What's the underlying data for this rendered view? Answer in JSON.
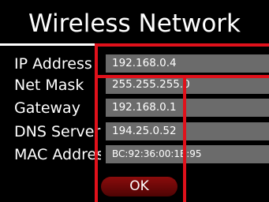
{
  "window": {
    "title": "Wireless Network"
  },
  "fields": [
    {
      "label": "IP Address",
      "value": "192.168.0.4"
    },
    {
      "label": "Net Mask",
      "value": "255.255.255.0"
    },
    {
      "label": "Gateway",
      "value": "192.168.0.1"
    },
    {
      "label": "DNS Server",
      "value": "194.25.0.52"
    },
    {
      "label": "MAC Address",
      "value": "BC:92:36:00:1B:95"
    }
  ],
  "actions": {
    "ok_label": "OK"
  },
  "colors": {
    "background": "#000000",
    "field_background": "#6b6b6b",
    "ok_button": "#7a0a0a",
    "highlight": "#e0111b"
  }
}
